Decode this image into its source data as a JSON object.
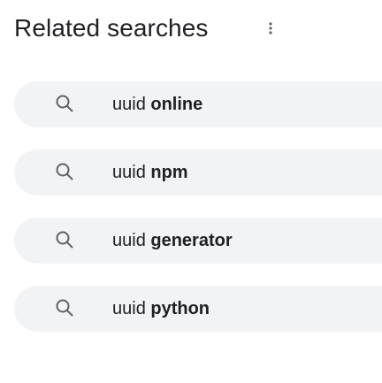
{
  "header": {
    "title": "Related searches"
  },
  "colors": {
    "text": "#202124",
    "chip_background": "#f1f3f4",
    "icon": "#5f6368"
  },
  "icons": {
    "more": "more-vert-icon",
    "search": "search-icon"
  },
  "searches": [
    {
      "query": "uuid",
      "suffix": "online"
    },
    {
      "query": "uuid",
      "suffix": "npm"
    },
    {
      "query": "uuid",
      "suffix": "generator"
    },
    {
      "query": "uuid",
      "suffix": "python"
    }
  ]
}
